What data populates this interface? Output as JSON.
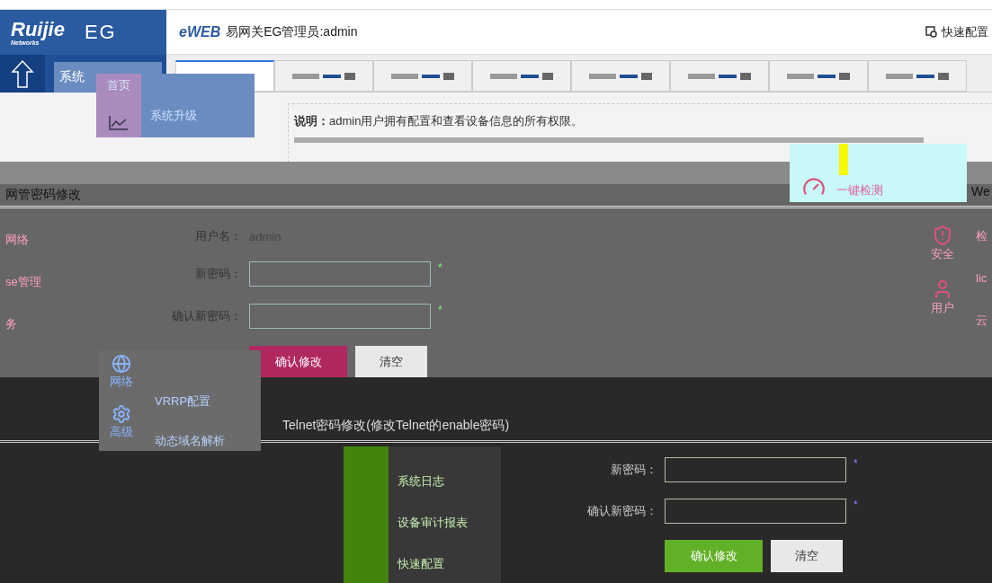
{
  "header": {
    "logo": "Ruijie",
    "logo_sub": "Networks",
    "product": "EG",
    "eweb_logo": "eWEB",
    "title": "易网关EG管理员:admin",
    "quick_config": "快速配置"
  },
  "nav": {
    "menu_button": "系统"
  },
  "tabs": [
    {
      "selected": true
    },
    {
      "selected": false
    },
    {
      "selected": false
    },
    {
      "selected": false
    },
    {
      "selected": false
    },
    {
      "selected": false
    },
    {
      "selected": false
    },
    {
      "selected": false
    }
  ],
  "popup_menu": {
    "side_label": "首页",
    "item": "系统升级"
  },
  "notice": {
    "text": "**说明：**admin用户拥有配置和查看设备信息的所有权限。"
  },
  "password_panel": {
    "title": "网管密码修改",
    "side_items": [
      "网络",
      "se管理",
      "务"
    ],
    "username_label": "用户名：",
    "username": "admin",
    "fields": [
      {
        "label": "新密码：",
        "mark": "*"
      },
      {
        "label": "确认新密码：",
        "mark": "*"
      }
    ],
    "buttons": [
      {
        "label": "确认修改",
        "kind": "primary"
      },
      {
        "label": "清空",
        "kind": "secondary"
      }
    ]
  },
  "quick_panel": {
    "check_label": "一键检测",
    "header_text": "We",
    "icons": [
      {
        "label": "安全",
        "kind": "shield"
      },
      {
        "label": "用户",
        "kind": "user"
      }
    ],
    "side_texts": [
      "检",
      "lic",
      "云"
    ]
  },
  "nav_menu": {
    "icons": [
      {
        "label": "网络",
        "kind": "globe"
      },
      {
        "label": "高级",
        "kind": "gear"
      }
    ],
    "items": [
      "VRRP配置",
      "动态域名解析"
    ]
  },
  "telnet_panel": {
    "title": "Telnet密码修改(修改Telnet的enable密码)",
    "fields": [
      {
        "label": "新密码：",
        "mark": "*"
      },
      {
        "label": "确认新密码：",
        "mark": "*"
      }
    ],
    "buttons": [
      {
        "label": "确认修改",
        "kind": "primary"
      },
      {
        "label": "清空",
        "kind": "secondary"
      }
    ]
  },
  "log_menu": {
    "items": [
      "系统日志",
      "设备审计报表",
      "快速配置"
    ]
  }
}
